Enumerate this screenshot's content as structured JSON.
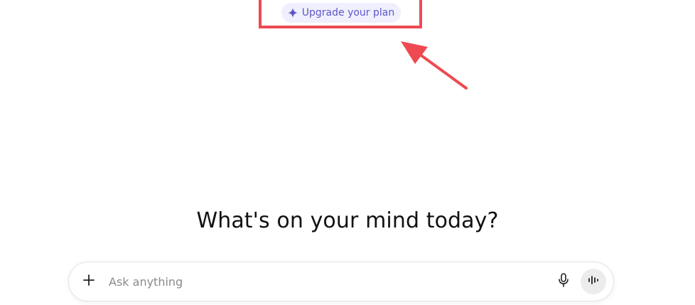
{
  "upgrade": {
    "label": "Upgrade your plan",
    "icon": "sparkle-icon",
    "accent_color": "#5b57c9"
  },
  "main": {
    "headline": "What's on your mind today?"
  },
  "composer": {
    "placeholder": "Ask anything",
    "value": "",
    "add_icon": "plus-icon",
    "mic_icon": "microphone-icon",
    "voice_icon": "voice-mode-icon"
  },
  "annotation": {
    "color": "#ee4a52"
  }
}
